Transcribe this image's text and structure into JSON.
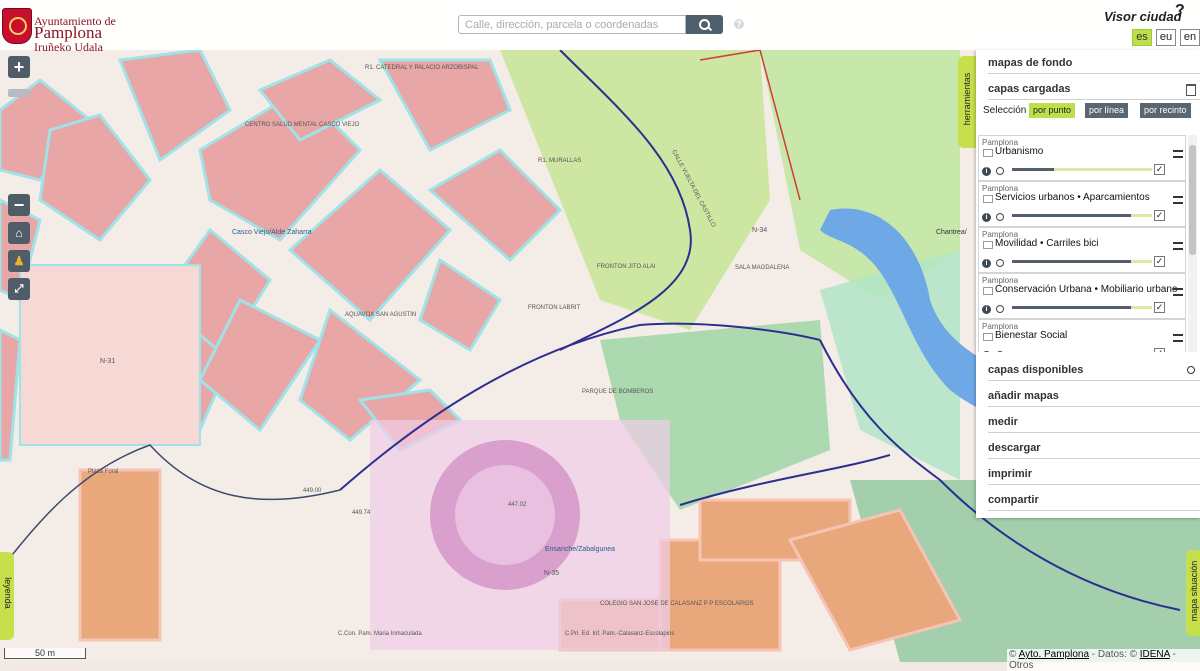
{
  "header": {
    "logo_line1": "Ayuntamiento de",
    "logo_line2": "Pamplona",
    "logo_line3": "Iruñeko Udala",
    "search_placeholder": "Calle, dirección, parcela o coordenadas",
    "app_title": "Visor ciudad",
    "help_label": "?",
    "languages": [
      "es",
      "eu",
      "en"
    ],
    "active_language": "es"
  },
  "map_controls": {
    "zoom_in": "+",
    "zoom_out": "−"
  },
  "map_labels": [
    "R1. CATEDRAL Y PALACIO ARZOBISPAL",
    "CENTRO SALUD MENTAL CASCO VIEJO",
    "Casco Viejo/Alde Zaharra",
    "AQUAVOX SAN AGUSTIN",
    "FRONTON JITO ALAI",
    "FRONTON LABRIT",
    "SALA MAGDALENA",
    "PARQUE DE BOMBEROS",
    "Ensanche/Zabalgunea",
    "COLEGIO SAN JOSE DE CALASANZ P P ESCOLAPIOS",
    "C.Con. Pam. Maria Inmaculada",
    "C.Pri. Ed. Inf. Pam.-Calasanz-Escolapios",
    "Plaza Foral",
    "Chantrea/",
    "R1. MURALLAS",
    "CALLE VUELTA DEL CASTILLO",
    "N-31",
    "N-34",
    "N-35",
    "447.02",
    "449.00",
    "449.74"
  ],
  "panel": {
    "tools_tab": "herramientas",
    "basemaps": "mapas de fondo",
    "loaded_layers": "capas cargadas",
    "selection_label": "Selección",
    "selection_modes": [
      "por punto",
      "por línea",
      "por recinto"
    ],
    "active_mode": "por punto",
    "layers": [
      {
        "group": "Pamplona",
        "name": "Urbanismo",
        "opacity": 0.3,
        "checked": "✓"
      },
      {
        "group": "Pamplona",
        "name": "Servicios urbanos • Aparcamientos",
        "opacity": 0.85,
        "checked": "✓"
      },
      {
        "group": "Pamplona",
        "name": "Movilidad • Carriles bici",
        "opacity": 0.85,
        "checked": "✓"
      },
      {
        "group": "Pamplona",
        "name": "Conservación Urbana • Mobiliario urbano",
        "opacity": 0.85,
        "checked": "✓"
      },
      {
        "group": "Pamplona",
        "name": "Bienestar Social",
        "opacity": 0.85,
        "checked": "✓"
      }
    ],
    "menu": [
      "capas disponibles",
      "añadir mapas",
      "medir",
      "descargar",
      "imprimir",
      "compartir"
    ]
  },
  "side_tabs": {
    "legend": "leyenda",
    "situation": "mapa situación"
  },
  "scale": "50 m",
  "credits": {
    "prefix": "©",
    "author": "Ayto. Pamplona",
    "mid": " - Datos: ©",
    "source": "IDENA",
    "suffix": " - Otros"
  }
}
